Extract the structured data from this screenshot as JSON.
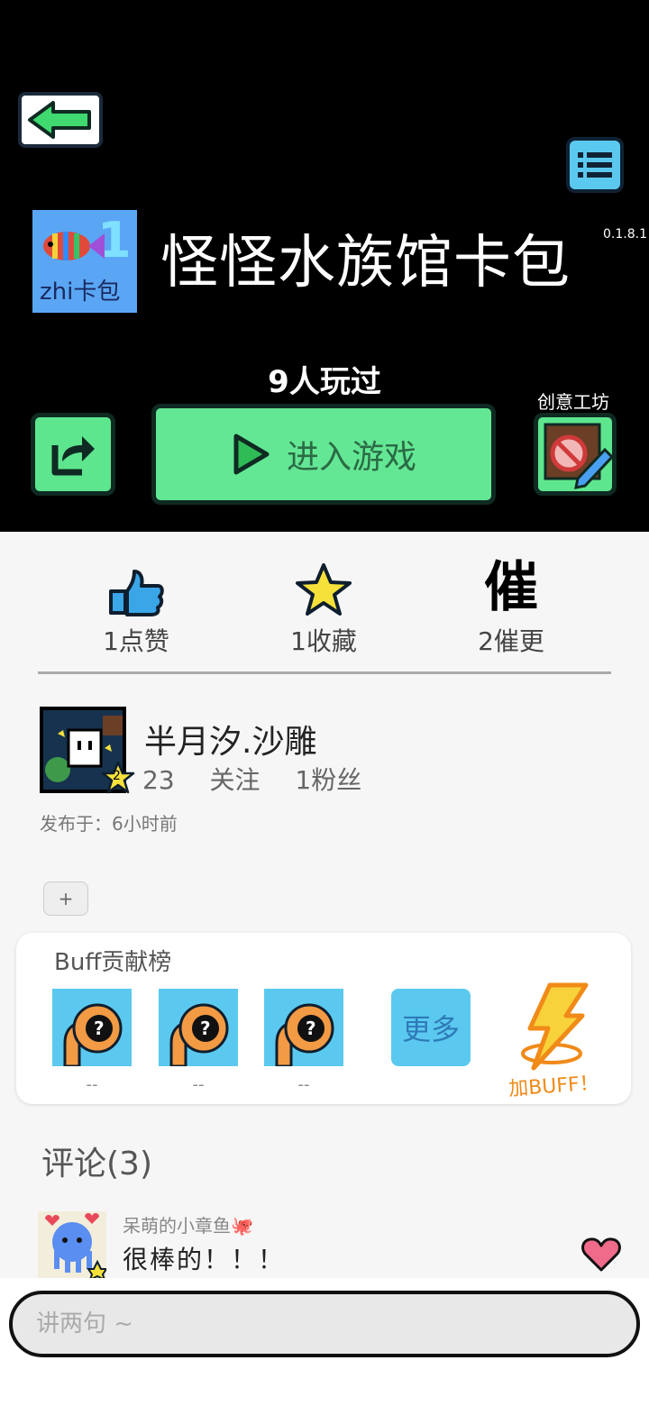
{
  "header": {
    "back_icon": "arrow-left-icon",
    "menu_icon": "list-icon",
    "version": "0.1.8.1"
  },
  "game": {
    "title": "怪怪水族馆卡包",
    "icon_text": "zhi卡包",
    "played": "9人玩过",
    "play_label": "进入游戏",
    "workshop_label": "创意工坊"
  },
  "stats": [
    {
      "label": "1点赞",
      "icon": "thumbs-up-icon"
    },
    {
      "label": "1收藏",
      "icon": "star-icon"
    },
    {
      "label": "2催更",
      "icon": "cui-icon",
      "glyph": "催"
    }
  ],
  "author": {
    "name": "半月汐.沙雕",
    "follow": "23 关注  1粉丝",
    "level": "2",
    "publish": "发布于：6小时前"
  },
  "tags": {
    "add": "+"
  },
  "buff": {
    "title": "Buff贡献榜",
    "slots": [
      {
        "name": "--"
      },
      {
        "name": "--"
      },
      {
        "name": "--"
      }
    ],
    "more": "更多",
    "action": "加BUFF！"
  },
  "comments": {
    "header": "评论(3)",
    "items": [
      {
        "user": "呆萌的小章鱼🐙",
        "text": "很棒的！！！"
      }
    ]
  },
  "input": {
    "placeholder": "讲两句 ~"
  },
  "colors": {
    "green": "#64e794",
    "blue": "#5bc9ef",
    "black": "#000000",
    "orange": "#f08a18"
  }
}
